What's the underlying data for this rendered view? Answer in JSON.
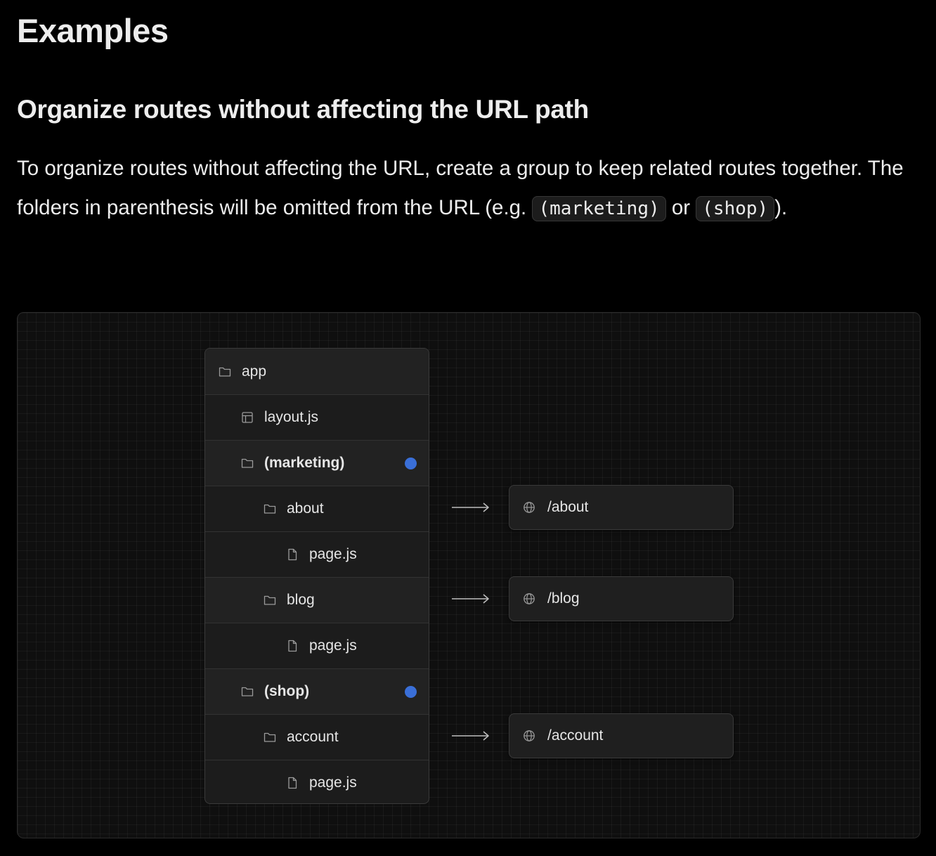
{
  "page_title": "Examples",
  "section_title": "Organize routes without affecting the URL path",
  "paragraph": {
    "text_before": "To organize routes without affecting the URL, create a group to keep related routes together. The folders in parenthesis will be omitted from the URL (e.g. ",
    "code_1": "(marketing)",
    "text_middle": " or ",
    "code_2": "(shop)",
    "text_after": ")."
  },
  "diagram": {
    "tree": [
      {
        "label": "app",
        "icon": "folder-icon",
        "bold": false,
        "group_marker": false
      },
      {
        "label": "layout.js",
        "icon": "layout-icon",
        "bold": false,
        "group_marker": false
      },
      {
        "label": "(marketing)",
        "icon": "folder-icon",
        "bold": true,
        "group_marker": true
      },
      {
        "label": "about",
        "icon": "folder-icon",
        "bold": false,
        "group_marker": false
      },
      {
        "label": "page.js",
        "icon": "file-icon",
        "bold": false,
        "group_marker": false
      },
      {
        "label": "blog",
        "icon": "folder-icon",
        "bold": false,
        "group_marker": false
      },
      {
        "label": "page.js",
        "icon": "file-icon",
        "bold": false,
        "group_marker": false
      },
      {
        "label": "(shop)",
        "icon": "folder-icon",
        "bold": true,
        "group_marker": true
      },
      {
        "label": "account",
        "icon": "folder-icon",
        "bold": false,
        "group_marker": false
      },
      {
        "label": "page.js",
        "icon": "file-icon",
        "bold": false,
        "group_marker": false
      }
    ],
    "routes": [
      {
        "path": "/about",
        "icon": "globe-icon"
      },
      {
        "path": "/blog",
        "icon": "globe-icon"
      },
      {
        "path": "/account",
        "icon": "globe-icon"
      }
    ],
    "colors": {
      "group_marker": "#3a6fd8",
      "background": "#000000",
      "panel": "#1c1c1c"
    }
  }
}
